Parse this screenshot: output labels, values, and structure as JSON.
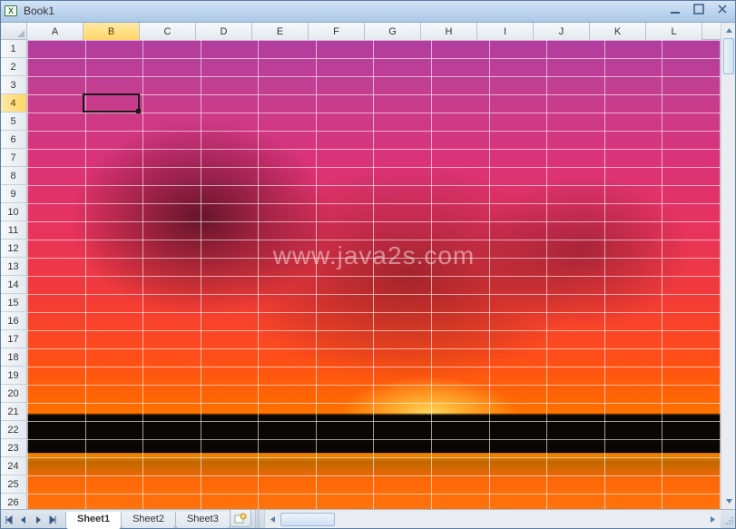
{
  "window": {
    "title": "Book1"
  },
  "columns": [
    "A",
    "B",
    "C",
    "D",
    "E",
    "F",
    "G",
    "H",
    "I",
    "J",
    "K",
    "L"
  ],
  "rows": [
    "1",
    "2",
    "3",
    "4",
    "5",
    "6",
    "7",
    "8",
    "9",
    "10",
    "11",
    "12",
    "13",
    "14",
    "15",
    "16",
    "17",
    "18",
    "19",
    "20",
    "21",
    "22",
    "23",
    "24",
    "25",
    "26"
  ],
  "active": {
    "col_label": "B",
    "row_label": "4",
    "col_index": 1,
    "row_index": 3
  },
  "sheets": {
    "tabs": [
      {
        "label": "Sheet1",
        "active": true
      },
      {
        "label": "Sheet2",
        "active": false
      },
      {
        "label": "Sheet3",
        "active": false
      }
    ]
  },
  "watermark": "www.java2s.com",
  "background": {
    "description": "sunset-photo"
  }
}
